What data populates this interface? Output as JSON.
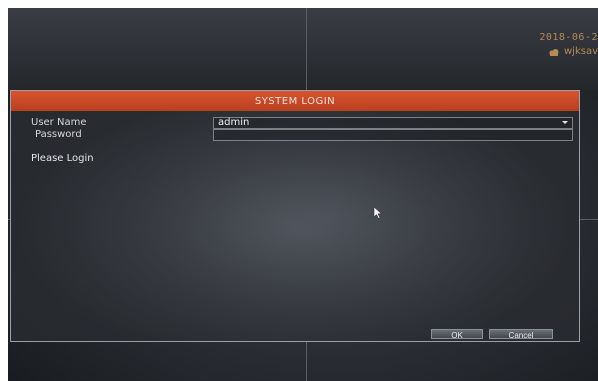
{
  "status": {
    "datetime": "2018-06-2",
    "user": "wjksav"
  },
  "login_dialog": {
    "title": "SYSTEM LOGIN",
    "username_label": "User Name",
    "username_value": "admin",
    "password_label": "Password",
    "password_value": "",
    "status_message": "Please Login",
    "ok_label": "OK",
    "cancel_label": "Cancel"
  },
  "colors": {
    "title_bar": "#c9482a",
    "overlay_text": "#b58a57"
  }
}
